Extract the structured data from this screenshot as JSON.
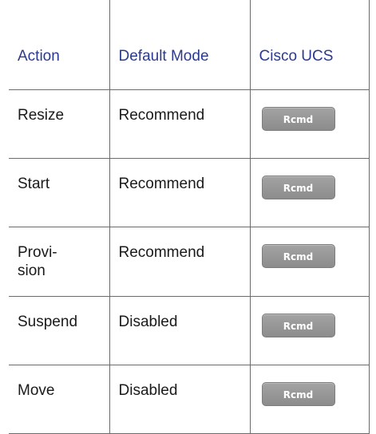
{
  "table": {
    "headers": [
      "Action",
      "Default Mode",
      "Cisco UCS"
    ],
    "rows": [
      {
        "action": "Resize",
        "default_mode": "Recommend",
        "cisco_ucs": "Rcmd"
      },
      {
        "action": "Start",
        "default_mode": "Recommend",
        "cisco_ucs": "Rcmd"
      },
      {
        "action": "Provi-\nsion",
        "default_mode": "Recommend",
        "cisco_ucs": "Rcmd"
      },
      {
        "action": "Suspend",
        "default_mode": "Disabled",
        "cisco_ucs": "Rcmd"
      },
      {
        "action": "Move",
        "default_mode": "Disabled",
        "cisco_ucs": "Rcmd"
      }
    ]
  },
  "colors": {
    "header_text": "#2b3a8f",
    "button_bg": "#969696",
    "border": "#6b6b6b"
  }
}
